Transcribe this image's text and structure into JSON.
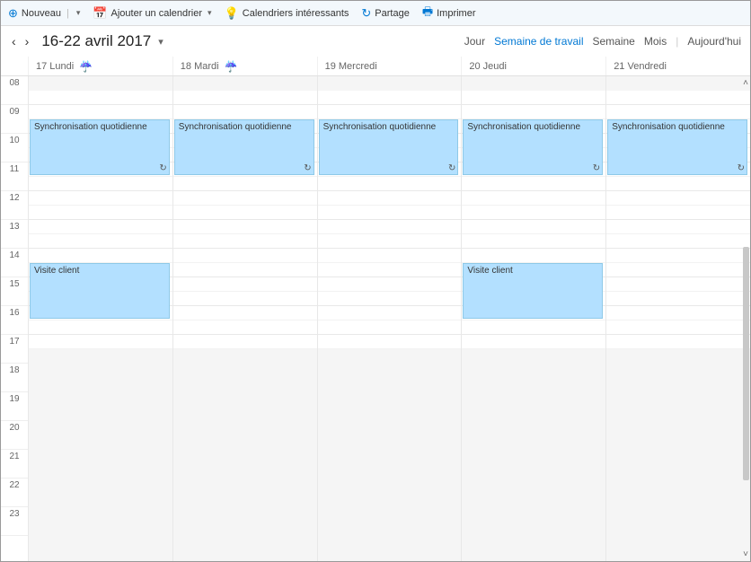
{
  "toolbar": {
    "new_label": "Nouveau",
    "add_calendar_label": "Ajouter un calendrier",
    "interesting_calendars_label": "Calendriers intéressants",
    "share_label": "Partage",
    "print_label": "Imprimer"
  },
  "header": {
    "date_range": "16-22 avril 2017"
  },
  "views": {
    "day": "Jour",
    "workweek": "Semaine de travail",
    "week": "Semaine",
    "month": "Mois",
    "today": "Aujourd'hui"
  },
  "days": [
    {
      "label": "17 Lundi",
      "weather": true
    },
    {
      "label": "18 Mardi",
      "weather": true
    },
    {
      "label": "19 Mercredi",
      "weather": false
    },
    {
      "label": "20 Jeudi",
      "weather": false
    },
    {
      "label": "21 Vendredi",
      "weather": false
    }
  ],
  "hours": [
    "08",
    "09",
    "10",
    "11",
    "12",
    "13",
    "14",
    "15",
    "16",
    "17",
    "18",
    "19",
    "20",
    "21",
    "22",
    "23"
  ],
  "events": {
    "sync_label": "Synchronisation quotidienne",
    "visit_label": "Visite client",
    "sync": {
      "start_hour": "09",
      "end_hour": "11",
      "recurring": true
    },
    "visit": {
      "start_hour": "14",
      "end_hour": "16",
      "recurring": false
    },
    "schedule": [
      [
        "sync",
        "visit"
      ],
      [
        "sync"
      ],
      [
        "sync"
      ],
      [
        "sync",
        "visit"
      ],
      [
        "sync"
      ]
    ]
  }
}
